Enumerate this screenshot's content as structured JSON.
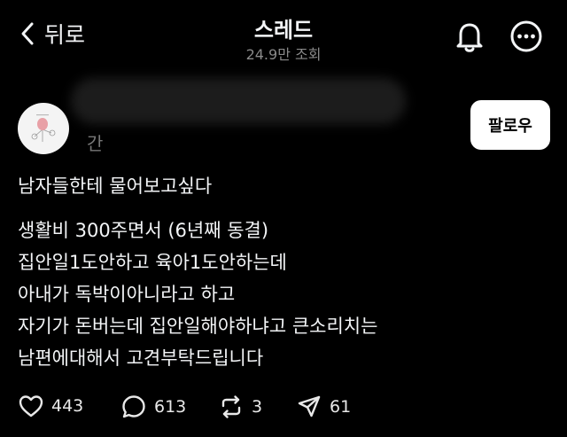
{
  "header": {
    "back_label": "뒤로",
    "title": "스레드",
    "views": "24.9만 조회"
  },
  "post": {
    "username": "간",
    "follow_label": "팔로우",
    "first_line": "남자들한테 물어보고싶다",
    "body_lines": [
      "생활비 300주면서 (6년째 동결)",
      "집안일1도안하고 육아1도안하는데",
      "아내가 독박이아니라고 하고",
      "자기가 돈버는데 집안일해야하냐고 큰소리치는",
      "남편에대해서 고견부탁드립니다"
    ]
  },
  "actions": {
    "likes": "443",
    "comments": "613",
    "reposts": "3",
    "shares": "61"
  },
  "icons": {
    "back": "chevron-left-icon",
    "bell": "bell-icon",
    "more": "more-icon",
    "like": "heart-icon",
    "comment": "comment-icon",
    "repost": "repost-icon",
    "share": "send-icon"
  },
  "colors": {
    "background": "#000000",
    "text": "#f3f5f7",
    "muted": "#8a8a8a",
    "follow_button": "#ffffff"
  }
}
